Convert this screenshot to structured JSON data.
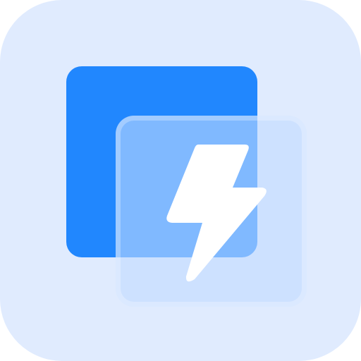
{
  "app_icon": {
    "name": "lightning-app-icon",
    "colors": {
      "background": "#e0ebfe",
      "back_square": "#2187fe",
      "front_card": "#bfdaff",
      "bolt": "#ffffff"
    },
    "icons": [
      "back-square",
      "front-card",
      "lightning-bolt-icon"
    ]
  }
}
